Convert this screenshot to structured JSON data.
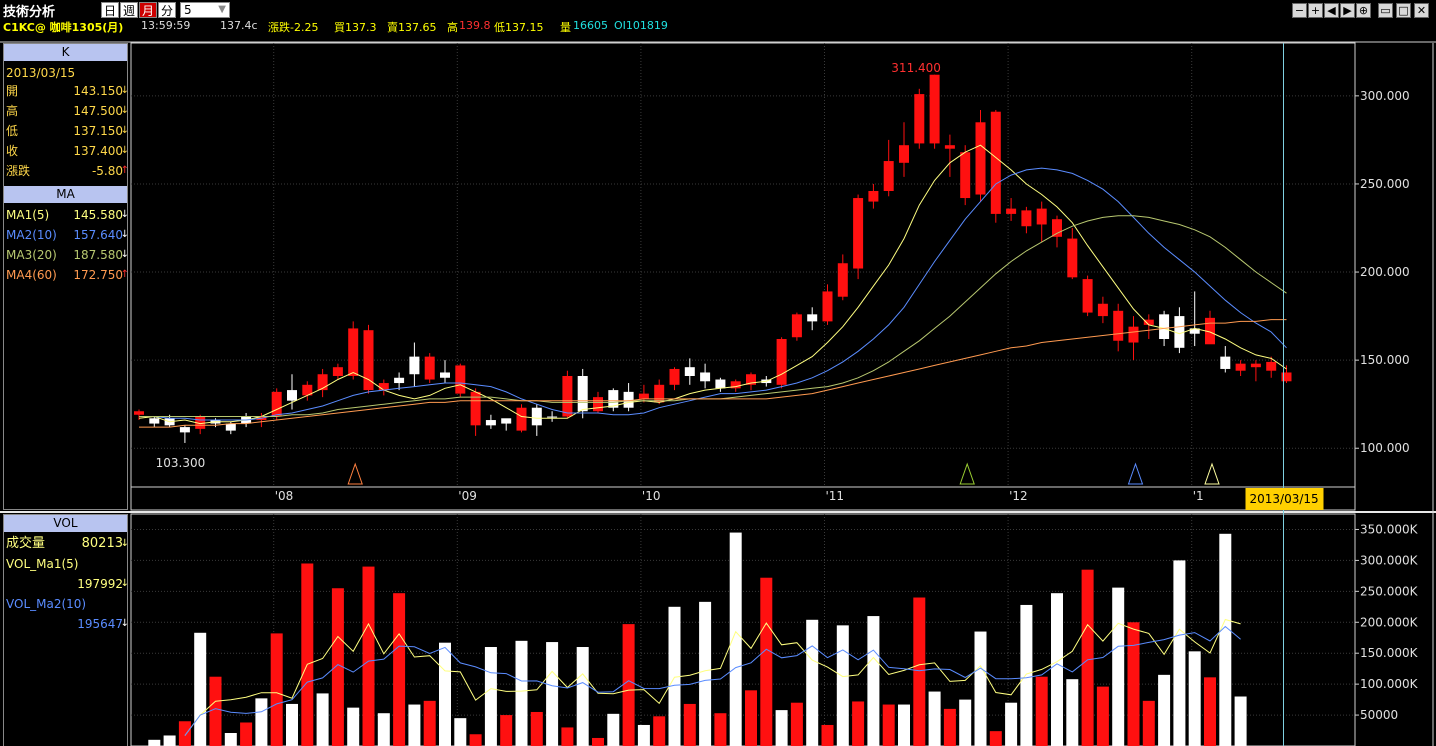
{
  "app": {
    "title": "技術分析",
    "interval": "5"
  },
  "period_buttons": [
    {
      "label": "日",
      "active": false
    },
    {
      "label": "週",
      "active": false
    },
    {
      "label": "月",
      "active": true
    },
    {
      "label": "分",
      "active": false
    }
  ],
  "window_buttons": [
    "−",
    "+",
    "◀",
    "▶",
    "⊕",
    "▭",
    "□",
    "✕"
  ],
  "quote": {
    "symbol": "C1KC@ 咖啡1305(月)",
    "time": "13:59:59",
    "last": "137.4c",
    "change": "漲跌-2.25",
    "bid": "買137.3",
    "ask": "賣137.65",
    "high_label": "高",
    "high": "139.8",
    "low": "低137.15",
    "volume_label": "量",
    "volume": "16605",
    "oi": "OI101819"
  },
  "k_panel": {
    "header": "K",
    "date": "2013/03/15",
    "rows": [
      {
        "label": "開",
        "value": "143.150",
        "dir": "↓"
      },
      {
        "label": "高",
        "value": "147.500",
        "dir": "↓"
      },
      {
        "label": "低",
        "value": "137.150",
        "dir": "↓"
      },
      {
        "label": "收",
        "value": "137.400",
        "dir": "↓"
      },
      {
        "label": "漲跌",
        "value": "-5.80",
        "dir": "↑"
      }
    ]
  },
  "ma_panel": {
    "header": "MA",
    "rows": [
      {
        "label": "MA1(5)",
        "value": "145.580",
        "dir": "↓",
        "color": "#ffff80"
      },
      {
        "label": "MA2(10)",
        "value": "157.640",
        "dir": "↓",
        "color": "#5a8cff"
      },
      {
        "label": "MA3(20)",
        "value": "187.580",
        "dir": "↓",
        "color": "#b8c870"
      },
      {
        "label": "MA4(60)",
        "value": "172.750",
        "dir": "↑",
        "color": "#ff9a50"
      }
    ]
  },
  "vol_panel": {
    "header": "VOL",
    "rows": [
      {
        "label": "成交量",
        "value": "80213",
        "dir": "↓"
      },
      {
        "label": "VOL_Ma1(5)",
        "value": "",
        "dir": ""
      },
      {
        "label": "",
        "value": "197992",
        "dir": "↓"
      },
      {
        "label": "VOL_Ma2(10)",
        "value": "",
        "dir": ""
      },
      {
        "label": "",
        "value": "195647",
        "dir": "↓"
      }
    ]
  },
  "chart_data": [
    {
      "type": "candlestick",
      "series_name": "C1KC@ 咖啡1305(月)",
      "ylim": [
        78,
        330
      ],
      "yticks": [
        100,
        150,
        200,
        250,
        300
      ],
      "ytick_labels": [
        "100.000",
        "150.000",
        "200.000",
        "250.000",
        "300.000"
      ],
      "xtick_labels": [
        {
          "label": "'08",
          "index": 9
        },
        {
          "label": "'09",
          "index": 21
        },
        {
          "label": "'10",
          "index": 33
        },
        {
          "label": "'11",
          "index": 45
        },
        {
          "label": "'12",
          "index": 57
        },
        {
          "label": "'1",
          "index": 69
        }
      ],
      "cursor_label": "2013/03/15",
      "max_annotation": {
        "label": "311.400",
        "index": 51
      },
      "min_annotation": {
        "label": "103.300",
        "index": 2
      },
      "signal_markers": [
        {
          "index": 14,
          "color": "#ff8040"
        },
        {
          "index": 54,
          "color": "#9acd32"
        },
        {
          "index": 65,
          "color": "#5a8cff"
        },
        {
          "index": 70,
          "color": "#ffffa0"
        }
      ],
      "ohlc": [
        [
          121,
          119,
          116,
          122
        ],
        [
          114,
          117,
          112,
          118
        ],
        [
          113,
          117,
          112,
          119
        ],
        [
          109,
          112,
          103,
          113
        ],
        [
          118,
          111,
          108,
          119
        ],
        [
          114,
          116,
          112,
          117
        ],
        [
          110,
          114,
          108,
          115
        ],
        [
          114,
          118,
          112,
          120
        ],
        [
          118,
          116,
          112,
          120
        ],
        [
          132,
          118,
          116,
          134
        ],
        [
          127,
          133,
          122,
          142
        ],
        [
          136,
          130,
          127,
          138
        ],
        [
          142,
          133,
          129,
          145
        ],
        [
          146,
          141,
          139,
          148
        ],
        [
          168,
          141,
          139,
          172
        ],
        [
          167,
          133,
          131,
          170
        ],
        [
          137,
          133,
          130,
          139
        ],
        [
          137,
          140,
          133,
          143
        ],
        [
          142,
          152,
          135,
          160
        ],
        [
          152,
          139,
          137,
          154
        ],
        [
          140,
          143,
          137,
          150
        ],
        [
          147,
          131,
          129,
          148
        ],
        [
          132,
          113,
          107,
          134
        ],
        [
          113,
          116,
          111,
          119
        ],
        [
          114,
          117,
          110,
          116
        ],
        [
          123,
          110,
          109,
          125
        ],
        [
          113,
          123,
          107,
          125
        ],
        [
          118,
          118,
          115,
          121
        ],
        [
          141,
          118,
          117,
          144
        ],
        [
          121,
          141,
          117,
          145
        ],
        [
          129,
          121,
          120,
          132
        ],
        [
          123,
          133,
          121,
          134
        ],
        [
          123,
          132,
          121,
          137
        ],
        [
          131,
          128,
          126,
          136
        ],
        [
          136,
          126,
          125,
          139
        ],
        [
          145,
          136,
          133,
          146
        ],
        [
          141,
          146,
          136,
          151
        ],
        [
          138,
          143,
          134,
          148
        ],
        [
          134,
          139,
          132,
          140
        ],
        [
          138,
          134,
          132,
          139
        ],
        [
          142,
          136,
          133,
          143
        ],
        [
          137,
          139,
          135,
          141
        ],
        [
          162,
          136,
          134,
          163
        ],
        [
          176,
          163,
          161,
          177
        ],
        [
          172,
          176,
          167,
          180
        ],
        [
          189,
          172,
          170,
          193
        ],
        [
          205,
          186,
          184,
          210
        ],
        [
          242,
          202,
          196,
          244
        ],
        [
          246,
          240,
          236,
          250
        ],
        [
          263,
          246,
          243,
          275
        ],
        [
          272,
          262,
          254,
          285
        ],
        [
          301,
          273,
          270,
          304
        ],
        [
          312,
          273,
          270,
          312
        ],
        [
          272,
          270,
          254,
          278
        ],
        [
          268,
          242,
          238,
          272
        ],
        [
          285,
          244,
          240,
          292
        ],
        [
          291,
          233,
          228,
          292
        ],
        [
          236,
          233,
          229,
          242
        ],
        [
          235,
          226,
          222,
          237
        ],
        [
          236,
          227,
          217,
          240
        ],
        [
          230,
          220,
          214,
          232
        ],
        [
          219,
          197,
          196,
          225
        ],
        [
          196,
          177,
          175,
          198
        ],
        [
          182,
          175,
          171,
          186
        ],
        [
          178,
          161,
          155,
          182
        ],
        [
          169,
          160,
          150,
          175
        ],
        [
          173,
          170,
          162,
          176
        ],
        [
          162,
          176,
          158,
          178
        ],
        [
          157,
          175,
          154,
          180
        ],
        [
          165,
          168,
          158,
          189
        ],
        [
          174,
          159,
          160,
          178
        ],
        [
          145,
          152,
          143,
          158
        ],
        [
          148,
          144,
          141,
          150
        ],
        [
          148,
          146,
          138,
          150
        ],
        [
          149,
          144,
          140,
          152
        ],
        [
          143,
          138,
          137,
          147
        ]
      ],
      "ma_lines": [
        {
          "name": "MA1(5)",
          "color": "#ffff80",
          "values": [
            117,
            118,
            115,
            116,
            114,
            115,
            115,
            116,
            118,
            122,
            126,
            130,
            134,
            139,
            143,
            139,
            133,
            130,
            128,
            130,
            134,
            136,
            132,
            128,
            123,
            118,
            117,
            117,
            117,
            122,
            123,
            124,
            126,
            127,
            126,
            128,
            131,
            133,
            134,
            135,
            137,
            138,
            142,
            147,
            152,
            160,
            169,
            180,
            192,
            204,
            219,
            238,
            252,
            262,
            268,
            272,
            265,
            258,
            250,
            244,
            237,
            228,
            215,
            203,
            191,
            179,
            170,
            168,
            165,
            168,
            166,
            162,
            157,
            153,
            151,
            145
          ]
        },
        {
          "name": "MA2(10)",
          "color": "#5a8cff",
          "values": [
            118,
            118,
            117,
            117,
            116,
            116,
            116,
            116,
            117,
            119,
            120,
            122,
            124,
            127,
            130,
            132,
            133,
            134,
            135,
            136,
            137,
            137,
            136,
            135,
            132,
            128,
            125,
            122,
            120,
            120,
            120,
            119,
            119,
            120,
            123,
            125,
            127,
            129,
            131,
            131,
            132,
            133,
            135,
            137,
            140,
            144,
            149,
            155,
            162,
            170,
            180,
            193,
            206,
            218,
            230,
            240,
            250,
            255,
            258,
            259,
            258,
            256,
            252,
            247,
            240,
            231,
            222,
            214,
            207,
            200,
            192,
            184,
            177,
            171,
            166,
            157
          ]
        },
        {
          "name": "MA3(20)",
          "color": "#b8c870",
          "values": [
            118,
            118,
            118,
            118,
            118,
            118,
            118,
            118,
            118,
            118,
            119,
            119,
            120,
            122,
            123,
            124,
            125,
            126,
            127,
            128,
            128,
            129,
            129,
            129,
            128,
            127,
            127,
            126,
            126,
            126,
            126,
            126,
            127,
            127,
            127,
            127,
            128,
            128,
            128,
            129,
            130,
            131,
            132,
            133,
            134,
            135,
            137,
            140,
            144,
            149,
            155,
            161,
            168,
            175,
            183,
            191,
            199,
            206,
            212,
            217,
            222,
            226,
            229,
            231,
            232,
            232,
            231,
            229,
            227,
            224,
            220,
            214,
            207,
            200,
            194,
            188
          ]
        },
        {
          "name": "MA4(60)",
          "color": "#ff9a50",
          "values": [
            112,
            112,
            112,
            113,
            113,
            113,
            114,
            114,
            115,
            116,
            117,
            118,
            119,
            120,
            121,
            122,
            123,
            124,
            125,
            126,
            126,
            127,
            127,
            127,
            127,
            127,
            127,
            127,
            127,
            127,
            127,
            127,
            127,
            128,
            128,
            128,
            128,
            128,
            128,
            128,
            128,
            128,
            129,
            130,
            131,
            133,
            135,
            137,
            139,
            141,
            143,
            145,
            147,
            149,
            151,
            153,
            155,
            157,
            158,
            160,
            161,
            162,
            163,
            164,
            165,
            166,
            167,
            168,
            169,
            170,
            171,
            171,
            172,
            172,
            173,
            173
          ]
        }
      ]
    },
    {
      "type": "bar",
      "series_name": "VOL",
      "ylim": [
        0,
        375000
      ],
      "yticks": [
        50000,
        100000,
        150000,
        200000,
        250000,
        300000,
        350000
      ],
      "ytick_labels": [
        "50000",
        "100.000K",
        "150.000K",
        "200.000K",
        "250.000K",
        "300.000K",
        "350.000K"
      ],
      "values": [
        0,
        10000,
        17000,
        40000,
        183000,
        112000,
        21000,
        38000,
        77000,
        182000,
        68000,
        295000,
        85000,
        255000,
        62000,
        290000,
        53000,
        247000,
        67000,
        73000,
        167000,
        45000,
        19000,
        160000,
        50000,
        170000,
        55000,
        168000,
        30000,
        160000,
        13000,
        52000,
        197000,
        34000,
        48000,
        225000,
        68000,
        233000,
        53000,
        345000,
        90000,
        272000,
        58000,
        70000,
        204000,
        34000,
        195000,
        72000,
        210000,
        67000,
        67000,
        240000,
        88000,
        60000,
        75000,
        185000,
        24000,
        70000,
        228000,
        112000,
        247000,
        108000,
        285000,
        96000,
        256000,
        200000,
        73000,
        115000,
        300000,
        153000,
        111000,
        343000,
        80000
      ],
      "colors_red": [
        3,
        5,
        7,
        9,
        11,
        13,
        15,
        17,
        19,
        22,
        24,
        26,
        28,
        30,
        32,
        34,
        36,
        38,
        40,
        41,
        43,
        45,
        47,
        49,
        51,
        53,
        56,
        59,
        62,
        63,
        65,
        66,
        70
      ]
    }
  ]
}
